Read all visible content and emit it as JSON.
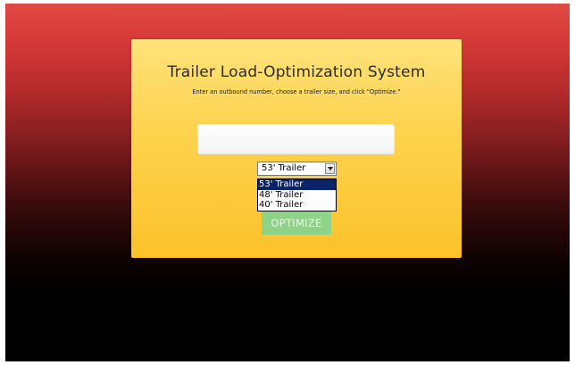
{
  "panel": {
    "title": "Trailer Load-Optimization System",
    "instructions": "Enter an outbound number, choose a trailer size, and click \"Optimize.\""
  },
  "outbound_input": {
    "value": "",
    "placeholder": ""
  },
  "trailer_select": {
    "selected": "53' Trailer",
    "options": [
      "53' Trailer",
      "48' Trailer",
      "40' Trailer"
    ],
    "highlighted_index": 0
  },
  "optimize_button": {
    "label": "OPTIMIZE"
  },
  "colors": {
    "background_top": "#e04a44",
    "background_bottom": "#000000",
    "panel": "#fdd24c",
    "button": "#8fd389",
    "option_highlight": "#0a246a"
  }
}
